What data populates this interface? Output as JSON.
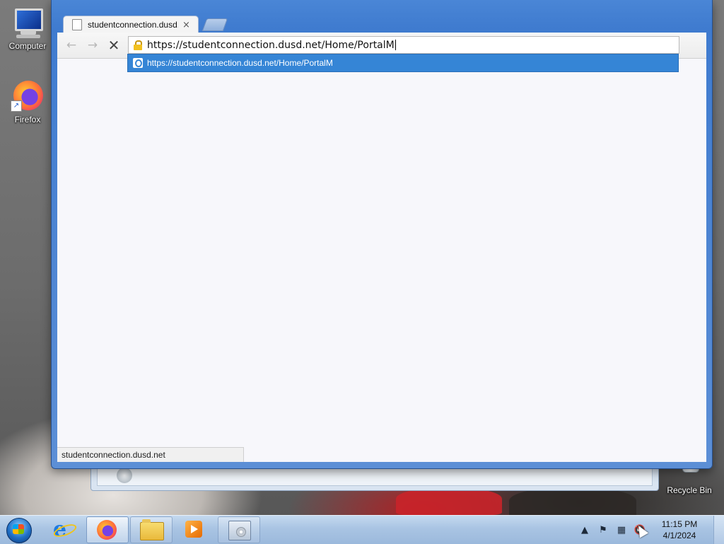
{
  "desktop": {
    "icons": [
      {
        "label": "Computer",
        "icon": "computer-icon"
      },
      {
        "label": "Firefox",
        "icon": "firefox-icon"
      },
      {
        "label": "Recycle Bin",
        "icon": "recycle-bin-icon"
      }
    ]
  },
  "browser": {
    "tab": {
      "title": "studentconnection.dusd.net/Home/PortalM",
      "close": "×"
    },
    "toolbar": {
      "back": "←",
      "forward": "→",
      "stop": "✕"
    },
    "omnibox": {
      "value": "https://studentconnection.dusd.net/Home/PortalM"
    },
    "suggestion": {
      "text": "https://studentconnection.dusd.net/Home/PortalM"
    },
    "status": "studentconnection.dusd.net"
  },
  "taskbar": {
    "pinned": [
      "internet-explorer-icon",
      "firefox-icon",
      "windows-explorer-icon",
      "media-player-icon",
      "installer-icon"
    ],
    "tray": {
      "time": "11:15 PM",
      "date": "4/1/2024",
      "show_hidden": "▲",
      "flag": "⚑",
      "network": "▦",
      "volume": "🔇"
    }
  },
  "colors": {
    "taskbar": "#a9c4e3",
    "titlebar": "#4a86d6",
    "selection": "#3585d6"
  }
}
